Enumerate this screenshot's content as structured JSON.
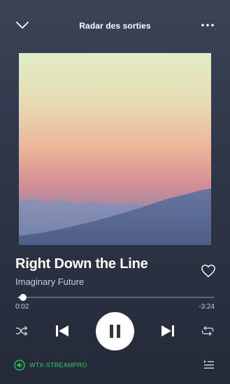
{
  "header": {
    "title": "Radar des sorties",
    "collapse_icon": "chevron-down-icon",
    "more_icon": "more-options-icon"
  },
  "track": {
    "title": "Right Down the Line",
    "artist": "Imaginary Future",
    "liked": false
  },
  "progress": {
    "elapsed": "0:02",
    "remaining": "-3:24",
    "fraction": 0.01
  },
  "controls": {
    "shuffle_icon": "shuffle-icon",
    "previous_icon": "skip-previous-icon",
    "play_state": "playing",
    "next_icon": "skip-next-icon",
    "repeat_icon": "repeat-icon"
  },
  "footer": {
    "device_label": "WTX-STREAMPRO",
    "device_icon": "speaker-icon",
    "queue_icon": "queue-icon"
  },
  "colors": {
    "accent": "#1ed760",
    "background": "#2f3749"
  }
}
